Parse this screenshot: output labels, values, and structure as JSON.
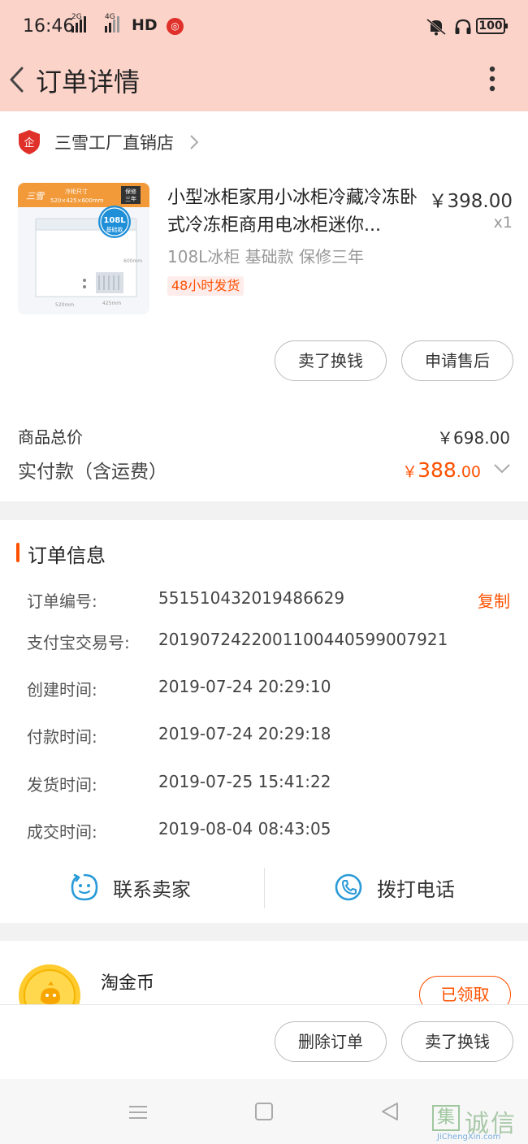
{
  "status_bar": {
    "time": "16:46",
    "signal1_label": "2G",
    "signal2_label": "4G",
    "hd_label": "HD",
    "battery_level": "100"
  },
  "header": {
    "title": "订单详情"
  },
  "shop": {
    "name": "三雪工厂直销店",
    "logo_text": "企"
  },
  "product": {
    "title": "小型冰柜家用小冰柜冷藏冷冻卧式冷冻柜商用电冰柜迷你...",
    "price": "￥398.00",
    "quantity": "x1",
    "spec": "108L冰柜 基础款 保修三年",
    "shipping_tag": "48小时发货",
    "image_badge_capacity": "108L",
    "image_badge_type": "基础款",
    "image_badge_warranty": "保修三年"
  },
  "item_actions": {
    "sell_label": "卖了换钱",
    "after_sale_label": "申请售后"
  },
  "totals": {
    "goods_total_label": "商品总价",
    "goods_total_value": "￥698.00",
    "paid_label": "实付款（含运费）",
    "paid_currency": "￥",
    "paid_integer": "388",
    "paid_decimal": ".00"
  },
  "order_info": {
    "section_title": "订单信息",
    "copy_label": "复制",
    "rows": [
      {
        "label": "订单编号:",
        "value": "551510432019486629"
      },
      {
        "label": "支付宝交易号:",
        "value": "2019072422001100440599007921"
      },
      {
        "label": "创建时间:",
        "value": "2019-07-24 20:29:10"
      },
      {
        "label": "付款时间:",
        "value": "2019-07-24 20:29:18"
      },
      {
        "label": "发货时间:",
        "value": "2019-07-25 15:41:22"
      },
      {
        "label": "成交时间:",
        "value": "2019-08-04 08:43:05"
      }
    ]
  },
  "contact": {
    "seller_label": "联系卖家",
    "call_label": "拨打电话"
  },
  "coins": {
    "name": "淘金币",
    "status_label": "已领取"
  },
  "bottom_actions": {
    "delete_label": "删除订单",
    "sell_label": "卖了换钱"
  },
  "watermark": {
    "box_char": "集",
    "text": "诚信",
    "url": "JiChengXin.com"
  },
  "colors": {
    "accent": "#ff5000",
    "header_bg": "#fcd3c9",
    "page_bg": "#f2f2f2"
  }
}
